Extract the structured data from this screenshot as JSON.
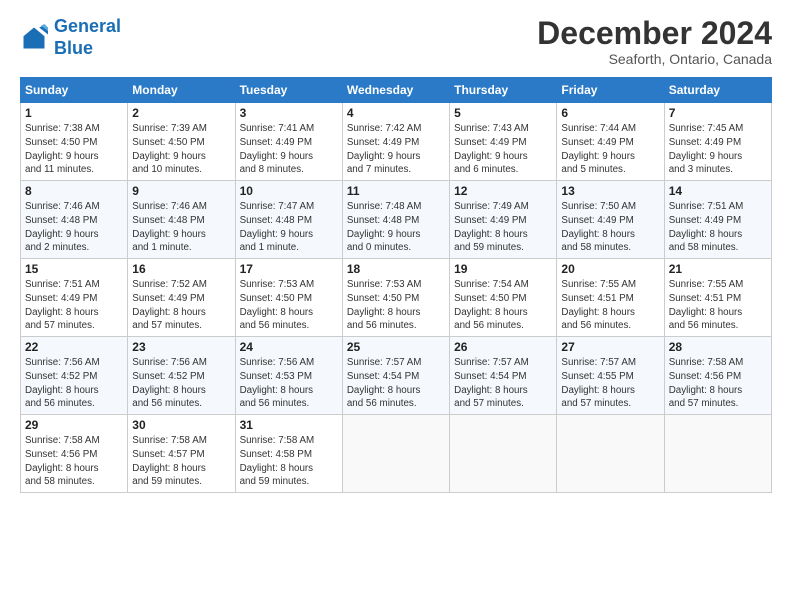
{
  "header": {
    "logo_line1": "General",
    "logo_line2": "Blue",
    "month": "December 2024",
    "location": "Seaforth, Ontario, Canada"
  },
  "weekdays": [
    "Sunday",
    "Monday",
    "Tuesday",
    "Wednesday",
    "Thursday",
    "Friday",
    "Saturday"
  ],
  "weeks": [
    [
      {
        "day": "1",
        "info": "Sunrise: 7:38 AM\nSunset: 4:50 PM\nDaylight: 9 hours\nand 11 minutes."
      },
      {
        "day": "2",
        "info": "Sunrise: 7:39 AM\nSunset: 4:50 PM\nDaylight: 9 hours\nand 10 minutes."
      },
      {
        "day": "3",
        "info": "Sunrise: 7:41 AM\nSunset: 4:49 PM\nDaylight: 9 hours\nand 8 minutes."
      },
      {
        "day": "4",
        "info": "Sunrise: 7:42 AM\nSunset: 4:49 PM\nDaylight: 9 hours\nand 7 minutes."
      },
      {
        "day": "5",
        "info": "Sunrise: 7:43 AM\nSunset: 4:49 PM\nDaylight: 9 hours\nand 6 minutes."
      },
      {
        "day": "6",
        "info": "Sunrise: 7:44 AM\nSunset: 4:49 PM\nDaylight: 9 hours\nand 5 minutes."
      },
      {
        "day": "7",
        "info": "Sunrise: 7:45 AM\nSunset: 4:49 PM\nDaylight: 9 hours\nand 3 minutes."
      }
    ],
    [
      {
        "day": "8",
        "info": "Sunrise: 7:46 AM\nSunset: 4:48 PM\nDaylight: 9 hours\nand 2 minutes."
      },
      {
        "day": "9",
        "info": "Sunrise: 7:46 AM\nSunset: 4:48 PM\nDaylight: 9 hours\nand 1 minute."
      },
      {
        "day": "10",
        "info": "Sunrise: 7:47 AM\nSunset: 4:48 PM\nDaylight: 9 hours\nand 1 minute."
      },
      {
        "day": "11",
        "info": "Sunrise: 7:48 AM\nSunset: 4:48 PM\nDaylight: 9 hours\nand 0 minutes."
      },
      {
        "day": "12",
        "info": "Sunrise: 7:49 AM\nSunset: 4:49 PM\nDaylight: 8 hours\nand 59 minutes."
      },
      {
        "day": "13",
        "info": "Sunrise: 7:50 AM\nSunset: 4:49 PM\nDaylight: 8 hours\nand 58 minutes."
      },
      {
        "day": "14",
        "info": "Sunrise: 7:51 AM\nSunset: 4:49 PM\nDaylight: 8 hours\nand 58 minutes."
      }
    ],
    [
      {
        "day": "15",
        "info": "Sunrise: 7:51 AM\nSunset: 4:49 PM\nDaylight: 8 hours\nand 57 minutes."
      },
      {
        "day": "16",
        "info": "Sunrise: 7:52 AM\nSunset: 4:49 PM\nDaylight: 8 hours\nand 57 minutes."
      },
      {
        "day": "17",
        "info": "Sunrise: 7:53 AM\nSunset: 4:50 PM\nDaylight: 8 hours\nand 56 minutes."
      },
      {
        "day": "18",
        "info": "Sunrise: 7:53 AM\nSunset: 4:50 PM\nDaylight: 8 hours\nand 56 minutes."
      },
      {
        "day": "19",
        "info": "Sunrise: 7:54 AM\nSunset: 4:50 PM\nDaylight: 8 hours\nand 56 minutes."
      },
      {
        "day": "20",
        "info": "Sunrise: 7:55 AM\nSunset: 4:51 PM\nDaylight: 8 hours\nand 56 minutes."
      },
      {
        "day": "21",
        "info": "Sunrise: 7:55 AM\nSunset: 4:51 PM\nDaylight: 8 hours\nand 56 minutes."
      }
    ],
    [
      {
        "day": "22",
        "info": "Sunrise: 7:56 AM\nSunset: 4:52 PM\nDaylight: 8 hours\nand 56 minutes."
      },
      {
        "day": "23",
        "info": "Sunrise: 7:56 AM\nSunset: 4:52 PM\nDaylight: 8 hours\nand 56 minutes."
      },
      {
        "day": "24",
        "info": "Sunrise: 7:56 AM\nSunset: 4:53 PM\nDaylight: 8 hours\nand 56 minutes."
      },
      {
        "day": "25",
        "info": "Sunrise: 7:57 AM\nSunset: 4:54 PM\nDaylight: 8 hours\nand 56 minutes."
      },
      {
        "day": "26",
        "info": "Sunrise: 7:57 AM\nSunset: 4:54 PM\nDaylight: 8 hours\nand 57 minutes."
      },
      {
        "day": "27",
        "info": "Sunrise: 7:57 AM\nSunset: 4:55 PM\nDaylight: 8 hours\nand 57 minutes."
      },
      {
        "day": "28",
        "info": "Sunrise: 7:58 AM\nSunset: 4:56 PM\nDaylight: 8 hours\nand 57 minutes."
      }
    ],
    [
      {
        "day": "29",
        "info": "Sunrise: 7:58 AM\nSunset: 4:56 PM\nDaylight: 8 hours\nand 58 minutes."
      },
      {
        "day": "30",
        "info": "Sunrise: 7:58 AM\nSunset: 4:57 PM\nDaylight: 8 hours\nand 59 minutes."
      },
      {
        "day": "31",
        "info": "Sunrise: 7:58 AM\nSunset: 4:58 PM\nDaylight: 8 hours\nand 59 minutes."
      },
      null,
      null,
      null,
      null
    ]
  ]
}
